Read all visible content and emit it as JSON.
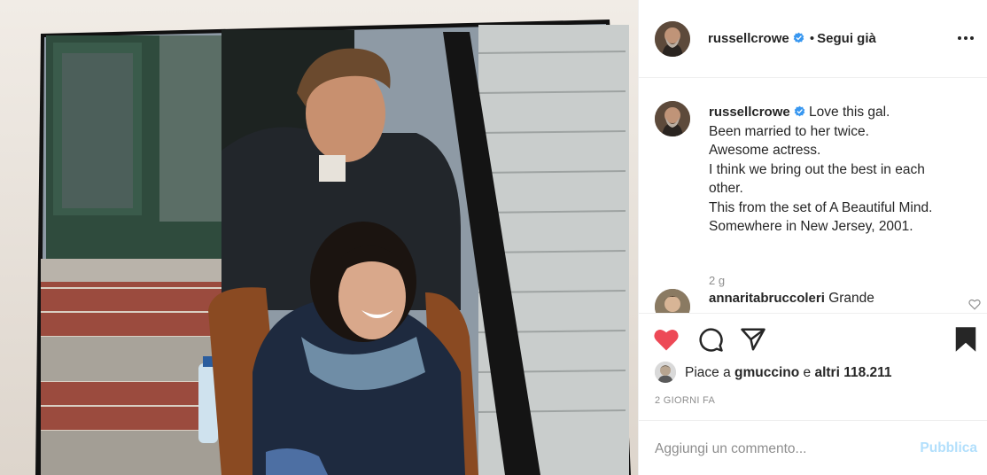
{
  "post": {
    "image_alt": "",
    "author": "russellcrowe",
    "follow_state": "Segui già",
    "separator": "•",
    "caption_lines": [
      "Love this gal.",
      "Been married to her twice.",
      "Awesome actress.",
      "I think we bring out the best in each",
      "other.",
      "This from the set of A Beautiful Mind.",
      "Somewhere in New Jersey, 2001."
    ],
    "caption_time": "2 g"
  },
  "comments": [
    {
      "user": "annaritabruccoleri",
      "text": "Grande"
    }
  ],
  "likes": {
    "prefix": "Piace a",
    "user": "gmuccino",
    "joiner": "e",
    "others": "altri 118.211"
  },
  "timestamp": "2 GIORNI FA",
  "add_comment": {
    "placeholder": "Aggiungi un commento...",
    "publish_label": "Pubblica"
  },
  "icons": {
    "more": "more-options-icon",
    "verified": "verified-badge-icon",
    "like": "heart-icon",
    "comment": "comment-icon",
    "share": "share-icon",
    "save": "bookmark-icon"
  },
  "colors": {
    "like": "#ed4956",
    "verified": "#3897f0",
    "publish_disabled": "#b2dffc",
    "muted": "#8e8e8e"
  }
}
